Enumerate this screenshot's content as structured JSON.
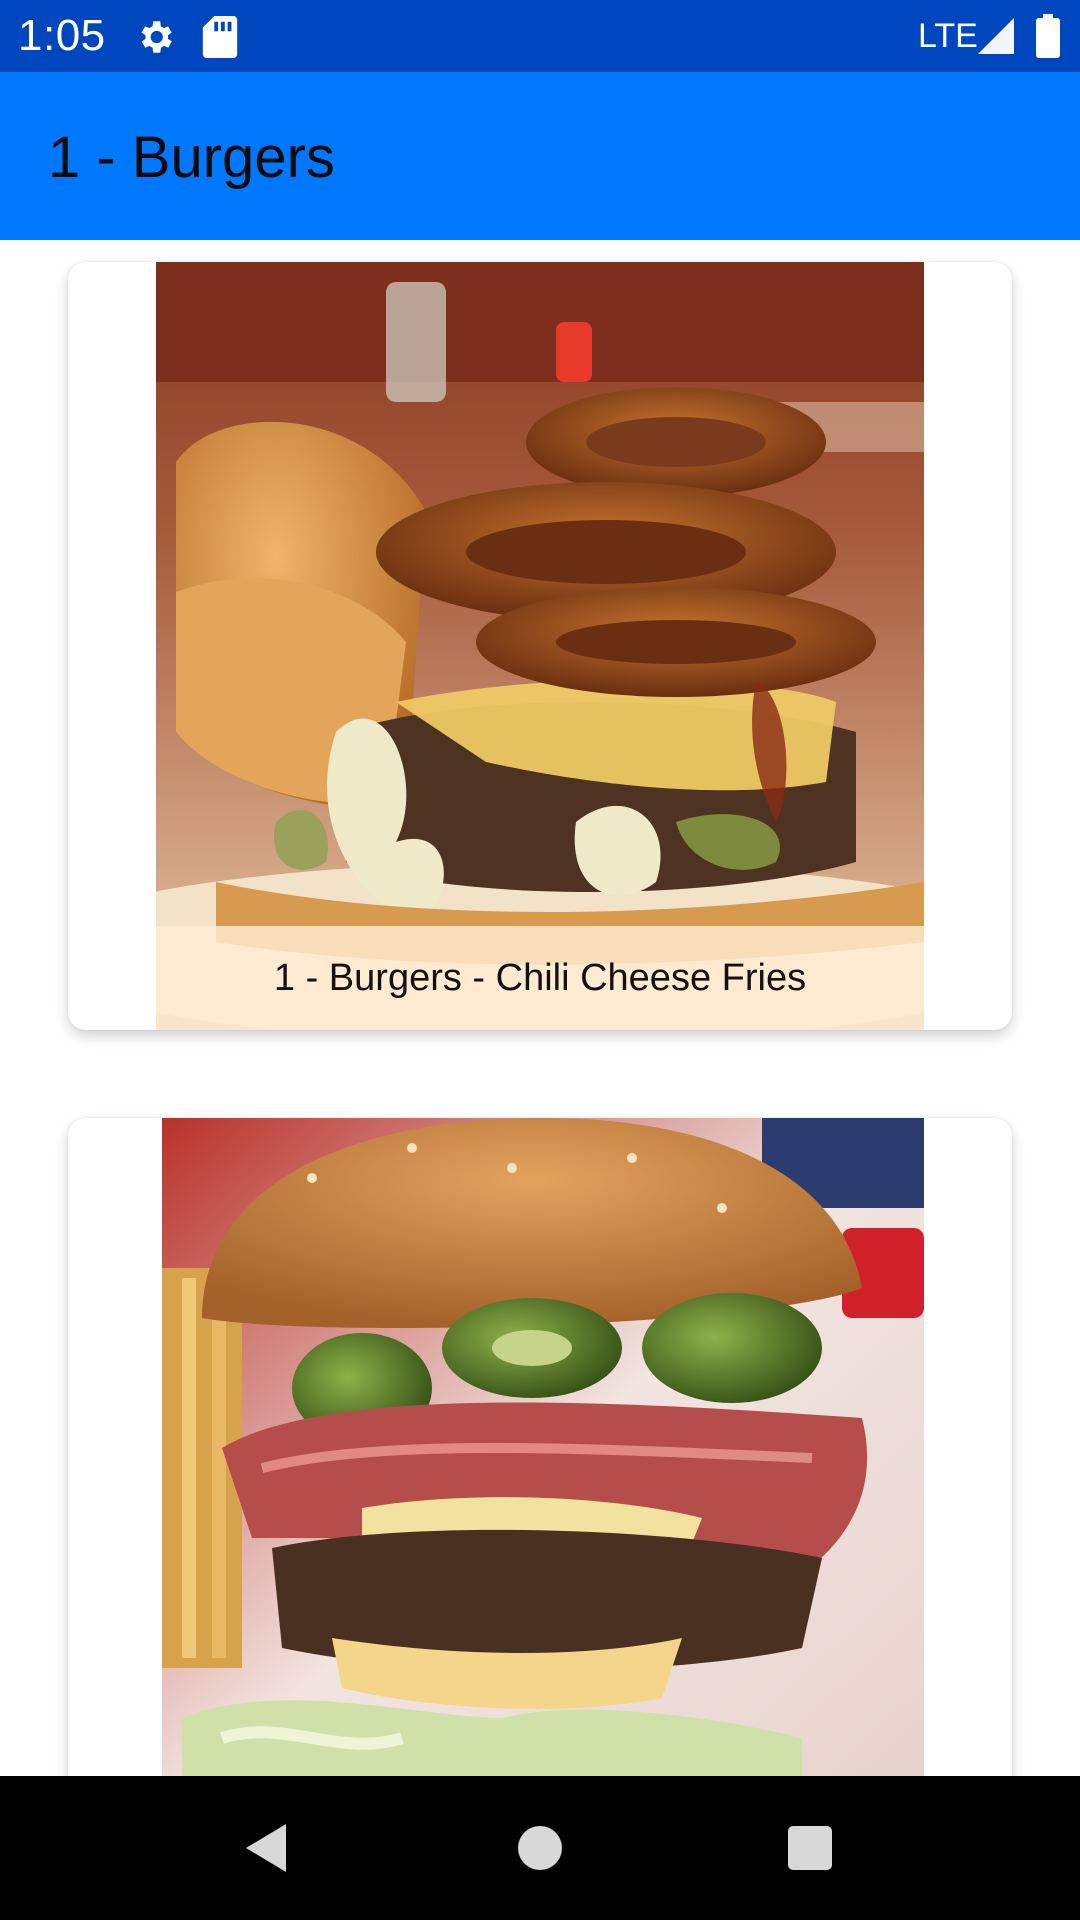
{
  "status_bar": {
    "time": "1:05",
    "network": "LTE",
    "icons": [
      "settings-icon",
      "sd-card-icon",
      "signal-icon",
      "battery-icon"
    ]
  },
  "app_bar": {
    "title": "1 - Burgers"
  },
  "cards": [
    {
      "caption": "1 - Burgers - Chili Cheese Fries",
      "image": "burger-with-onion-rings-photo"
    },
    {
      "caption": "",
      "image": "burger-with-jalapenos-and-pastrami-photo"
    }
  ],
  "nav_bar": {
    "icons": [
      "back-icon",
      "home-icon",
      "recents-icon"
    ]
  },
  "colors": {
    "status_bar": "#0047bf",
    "app_bar": "#0077ff",
    "nav_bar": "#000000"
  }
}
